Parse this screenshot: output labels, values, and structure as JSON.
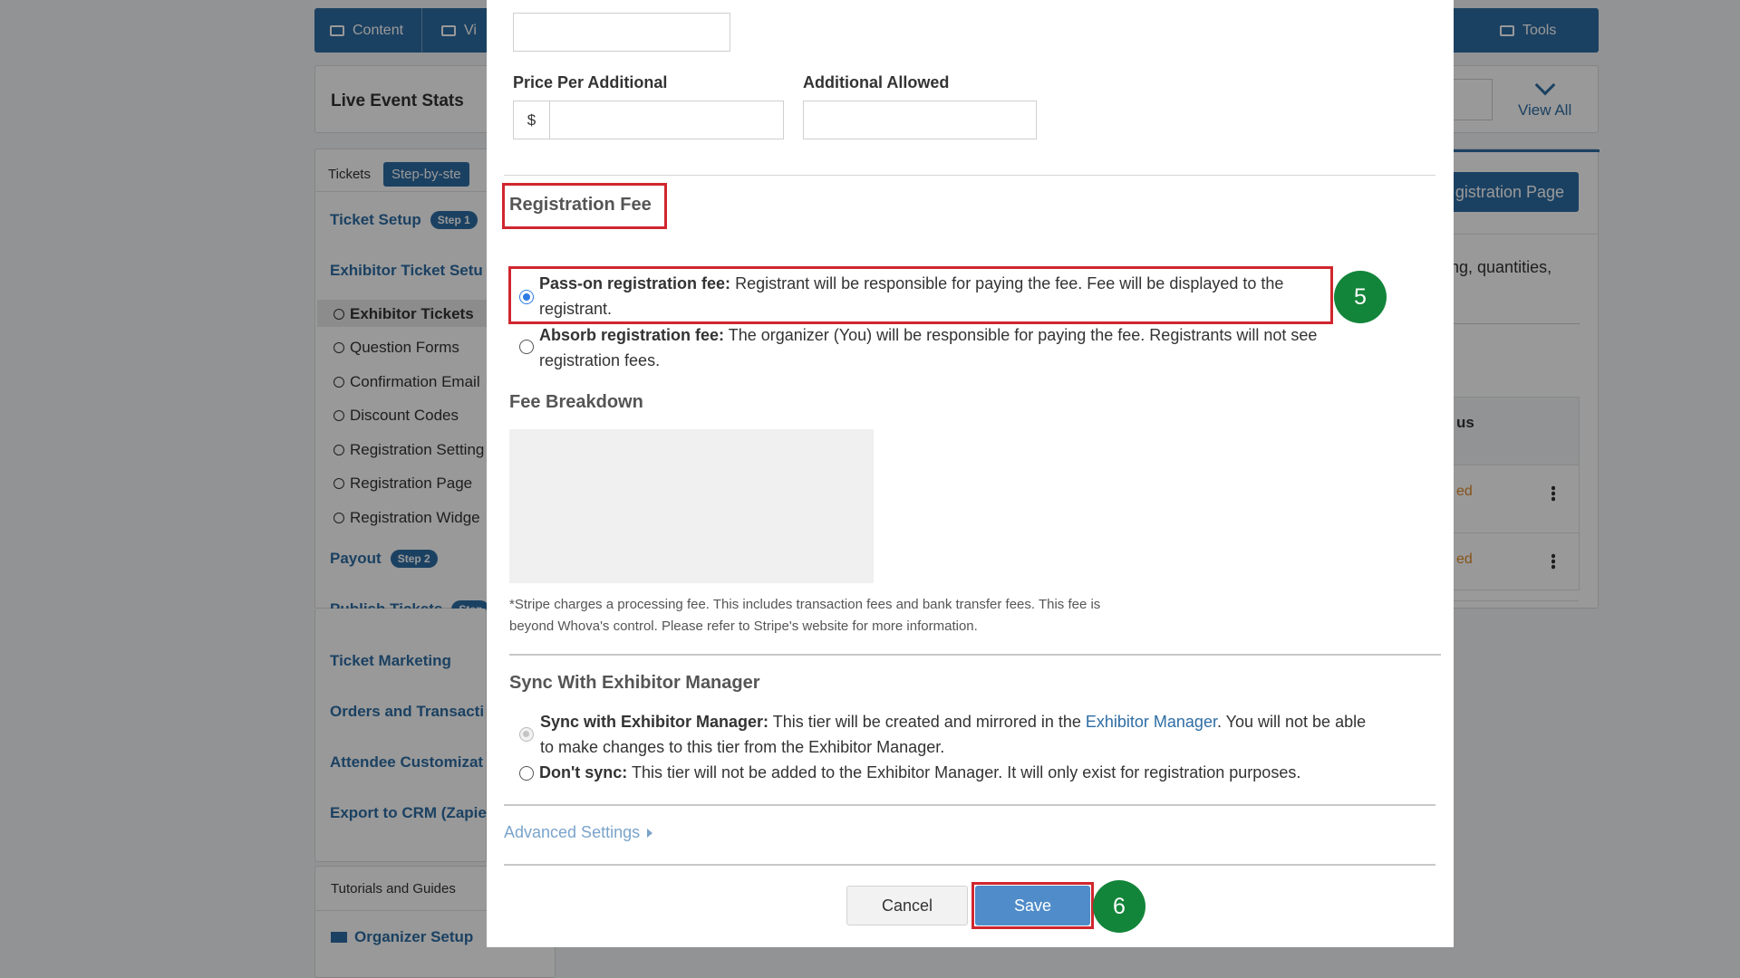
{
  "background": {
    "top_tabs": [
      "Content",
      "Vi",
      "Tools"
    ],
    "stats_title": "Live Event Stats",
    "view_all": "View All",
    "tabs": [
      "Tickets",
      "Step-by-ste"
    ],
    "nav": [
      {
        "label": "Ticket Setup",
        "step": "Step 1"
      },
      {
        "label": "Exhibitor Ticket Setu",
        "step": ""
      },
      {
        "label": "Payout",
        "step": "Step 2"
      },
      {
        "label": "Publish Tickets",
        "step": "Step"
      },
      {
        "label": "Ticket Marketing",
        "step": ""
      },
      {
        "label": "Orders and Transacti",
        "step": ""
      },
      {
        "label": "Attendee Customizat",
        "step": ""
      },
      {
        "label": "Export to CRM (Zapie",
        "step": ""
      }
    ],
    "sub_items": [
      "Exhibitor Tickets",
      "Question Forms",
      "Confirmation Email",
      "Discount Codes",
      "Registration Setting",
      "Registration Page",
      "Registration Widge"
    ],
    "right_button": "gistration Page",
    "right_text": "ng, quantities,",
    "table_header": "us",
    "table_cells": [
      "ed",
      "ed"
    ],
    "tutorials": "Tutorials and Guides",
    "organizer_setup": "Organizer Setup"
  },
  "modal": {
    "price_label": "Price Per Additional",
    "currency": "$",
    "allowed_label": "Additional Allowed",
    "reg_fee_heading": "Registration Fee",
    "pass_on": {
      "bold": "Pass-on registration fee:",
      "text": " Registrant will be responsible for paying the fee. Fee will be displayed to the registrant."
    },
    "absorb": {
      "bold": "Absorb registration fee:",
      "text": " The organizer (You) will be responsible for paying the fee. Registrants will not see registration fees."
    },
    "fee_breakdown": "Fee Breakdown",
    "stripe_note": "*Stripe charges a processing fee. This includes transaction fees and bank transfer fees. This fee is beyond Whova's control. Please refer to Stripe's website for more information.",
    "sync_heading": "Sync With Exhibitor Manager",
    "sync": {
      "bold": "Sync with Exhibitor Manager:",
      "text1": " This tier will be created and mirrored in the ",
      "link": "Exhibitor Manager",
      "text2": ". You will not be able to make changes to this tier from the Exhibitor Manager."
    },
    "dont_sync": {
      "bold": "Don't sync:",
      "text": " This tier will not be added to the Exhibitor Manager. It will only exist for registration purposes."
    },
    "advanced": "Advanced Settings",
    "cancel": "Cancel",
    "save": "Save"
  },
  "badges": [
    "5",
    "6"
  ],
  "colors": {
    "accent": "#2e6da4",
    "highlight": "#d0262f",
    "badge": "#13853a",
    "save": "#4f8cc9"
  }
}
